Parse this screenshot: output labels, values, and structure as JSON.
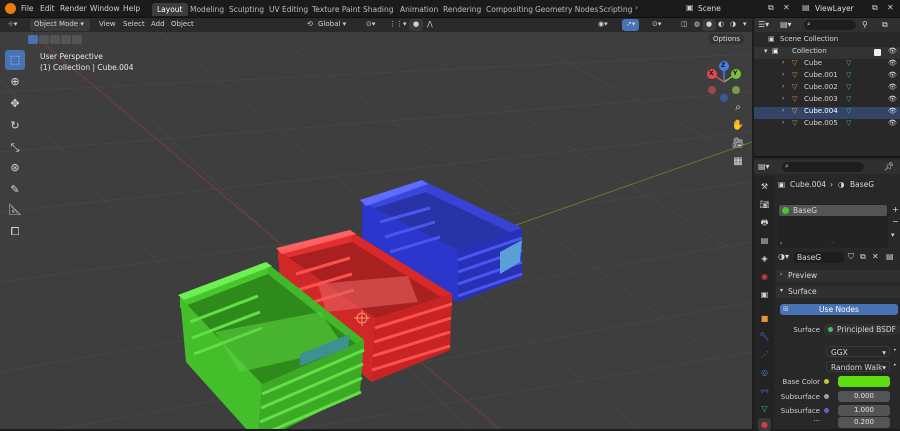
{
  "topbar": {
    "menus": [
      "File",
      "Edit",
      "Render",
      "Window",
      "Help"
    ],
    "workspaces": [
      "Layout",
      "Modeling",
      "Sculpting",
      "UV Editing",
      "Texture Paint",
      "Shading",
      "Animation",
      "Rendering",
      "Compositing",
      "Geometry Nodes",
      "Scripting"
    ],
    "active_workspace": "Layout",
    "scene_label": "Scene",
    "viewlayer_label": "ViewLayer"
  },
  "viewport_header": {
    "mode": "Object Mode",
    "menus": [
      "View",
      "Select",
      "Add",
      "Object"
    ],
    "orientation": "Global",
    "options_label": "Options"
  },
  "viewport": {
    "perspective_label": "User Perspective",
    "collection_label": "(1) Collection | Cube.004",
    "axes": {
      "x": "X",
      "y": "Y",
      "z": "Z"
    },
    "colors": {
      "background": "#3e3e3e",
      "grid": "#474747",
      "x_axis": "#8a3b3b",
      "y_axis": "#6a8a2a",
      "green_crate": "#47c62b",
      "red_crate": "#e02b2b",
      "blue_crate": "#2b34d6"
    }
  },
  "outliner": {
    "scene_collection": "Scene Collection",
    "collection": "Collection",
    "objects": [
      "Cube",
      "Cube.001",
      "Cube.002",
      "Cube.003",
      "Cube.004",
      "Cube.005"
    ]
  },
  "properties": {
    "object_name": "Cube.004",
    "material_name": "BaseG",
    "slot_name": "BaseG",
    "material_field": "BaseG",
    "preview_label": "Preview",
    "surface_section": "Surface",
    "use_nodes_label": "Use Nodes",
    "surface_label": "Surface",
    "surface_value": "Principled BSDF",
    "distribution": "GGX",
    "subsurface_method": "Random Walk",
    "base_color_label": "Base Color",
    "base_color": "#5ddf0f",
    "subsurface_label": "Subsurface",
    "subsurface_value": "0.000",
    "subsurface_radius_label": "Subsurface ...",
    "subsurface_radius_1": "1.000",
    "subsurface_radius_2": "0.200"
  }
}
